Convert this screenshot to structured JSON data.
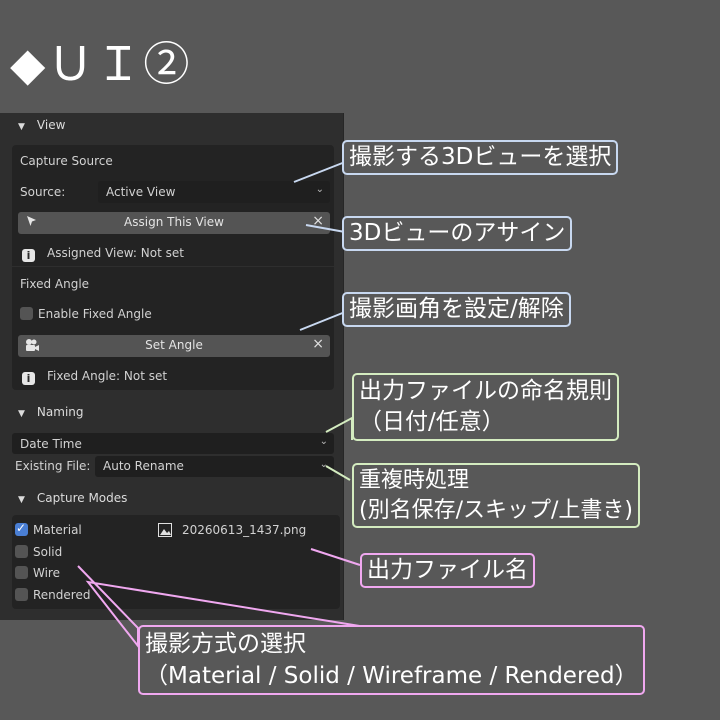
{
  "title": "◆ＵＩ②",
  "view": {
    "header": "View",
    "capture_source_label": "Capture Source",
    "source_label": "Source:",
    "source_value": "Active View",
    "assign_button": "Assign This View",
    "assigned_status": "Assigned View: Not set",
    "fixed_angle_label": "Fixed Angle",
    "enable_fixed_angle": "Enable Fixed Angle",
    "set_angle_button": "Set Angle",
    "fixed_angle_status": "Fixed Angle: Not set"
  },
  "naming": {
    "header": "Naming",
    "format_value": "Date Time",
    "existing_file_label": "Existing File:",
    "existing_file_value": "Auto Rename"
  },
  "capture_modes": {
    "header": "Capture Modes",
    "modes": [
      {
        "label": "Material",
        "checked": true
      },
      {
        "label": "Solid",
        "checked": false
      },
      {
        "label": "Wire",
        "checked": false
      },
      {
        "label": "Rendered",
        "checked": false
      }
    ],
    "output_filename": "20260613_1437.png"
  },
  "callouts": {
    "select_view": "撮影する3Dビューを選択",
    "assign_view": "3Dビューのアサイン",
    "set_angle": "撮影画角を設定/解除",
    "naming_line1": "出力ファイルの命名規則",
    "naming_line2": "（日付/任意）",
    "dup_line1": "重複時処理",
    "dup_line2": "(別名保存/スキップ/上書き)",
    "filename": "出力ファイル名",
    "mode_line1": "撮影方式の選択",
    "mode_line2": "（Material / Solid / Wireframe / Rendered）"
  },
  "colors": {
    "background": "#585858",
    "panel": "#2e2e2e",
    "callout_blue": "#c8d8f0",
    "callout_green": "#d4ecc0",
    "callout_pink": "#f0a8f0",
    "checkbox_on": "#4a7fd4"
  },
  "icons": [
    "cursor-arrow-icon",
    "info-icon",
    "camera-icon",
    "close-icon",
    "image-icon",
    "chevron-down-icon"
  ]
}
